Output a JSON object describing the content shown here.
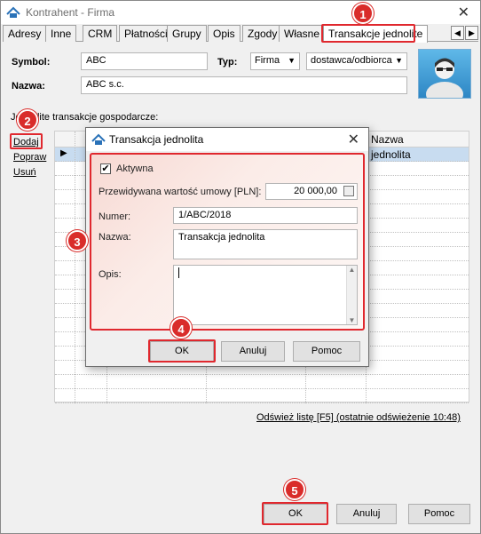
{
  "window": {
    "title": "Kontrahent - Firma"
  },
  "tabs": [
    "Adresy",
    "Inne",
    "CRM",
    "Płatności",
    "Grupy",
    "Opis",
    "Zgody",
    "Własne",
    "Transakcje jednolite"
  ],
  "form": {
    "symbol_label": "Symbol:",
    "symbol_value": "ABC",
    "typ_label": "Typ:",
    "typ_value": "Firma",
    "typ2_value": "dostawca/odbiorca",
    "nazwa_label": "Nazwa:",
    "nazwa_value": "ABC s.c."
  },
  "section": {
    "caption": "Jednolite transakcje gospodarcze:",
    "dodaj": "Dodaj",
    "popraw": "Popraw",
    "usun": "Usuń",
    "grid_header_nazwa": "Nazwa",
    "grid_row1_nazwa": "jednolita"
  },
  "dialog": {
    "title": "Transakcja jednolita",
    "aktywna_label": "Aktywna",
    "aktywna_checked": true,
    "wartosc_label": "Przewidywana wartość umowy [PLN]:",
    "wartosc_value": "20 000,00",
    "numer_label": "Numer:",
    "numer_value": "1/ABC/2018",
    "nazwa_label": "Nazwa:",
    "nazwa_value": "Transakcja jednolita",
    "opis_label": "Opis:",
    "opis_value": "",
    "ok": "OK",
    "anuluj": "Anuluj",
    "pomoc": "Pomoc"
  },
  "refresh_link": "Odśwież listę [F5] (ostatnie odświeżenie 10:48)",
  "bottom_buttons": {
    "ok": "OK",
    "anuluj": "Anuluj",
    "pomoc": "Pomoc"
  },
  "badges": [
    "1",
    "2",
    "3",
    "4",
    "5"
  ],
  "colors": {
    "highlight": "#e0282e",
    "badge": "#d92c2a",
    "selection": "#c8dcf0"
  }
}
